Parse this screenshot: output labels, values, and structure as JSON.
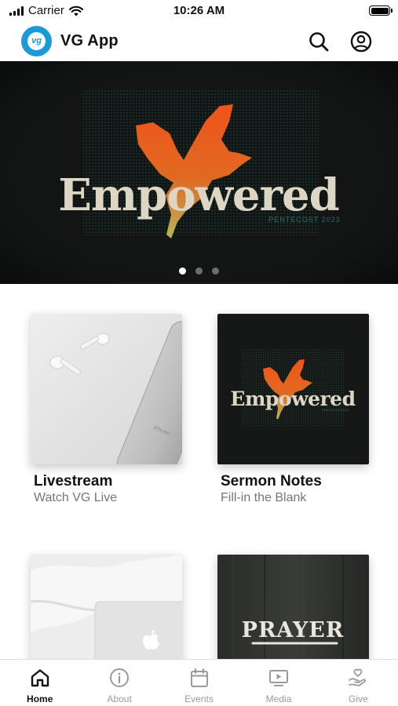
{
  "status_bar": {
    "carrier": "Carrier",
    "time": "10:26 AM"
  },
  "header": {
    "app_title": "VG App",
    "logo_text": "vg"
  },
  "hero": {
    "title": "Empowered",
    "subtitle": "PENTECOST 2023",
    "slide_count": 3,
    "active_slide": 0
  },
  "tiles": [
    {
      "title": "Livestream",
      "subtitle": "Watch VG Live",
      "phone_text": "iPhone"
    },
    {
      "title": "Sermon Notes",
      "subtitle": "Fill-in the Blank",
      "art_title": "Empowered",
      "art_subtitle": "PENTECOST 2023"
    },
    {
      "title": "",
      "subtitle": ""
    },
    {
      "title": "",
      "subtitle": "",
      "art_title": "PRAYER"
    }
  ],
  "tab_bar": {
    "items": [
      {
        "label": "Home",
        "icon": "home-icon",
        "active": true
      },
      {
        "label": "About",
        "icon": "info-icon",
        "active": false
      },
      {
        "label": "Events",
        "icon": "calendar-icon",
        "active": false
      },
      {
        "label": "Media",
        "icon": "media-icon",
        "active": false
      },
      {
        "label": "Give",
        "icon": "give-icon",
        "active": false
      }
    ]
  },
  "colors": {
    "brand_blue": "#1a9ad9",
    "hero_bg": "#121313",
    "dove_orange": "#e4551d",
    "dove_yellow": "#c9b25a",
    "title_cream": "#ddd6c4",
    "active_tab": "#111111",
    "inactive_tab": "#9a9a9a"
  }
}
